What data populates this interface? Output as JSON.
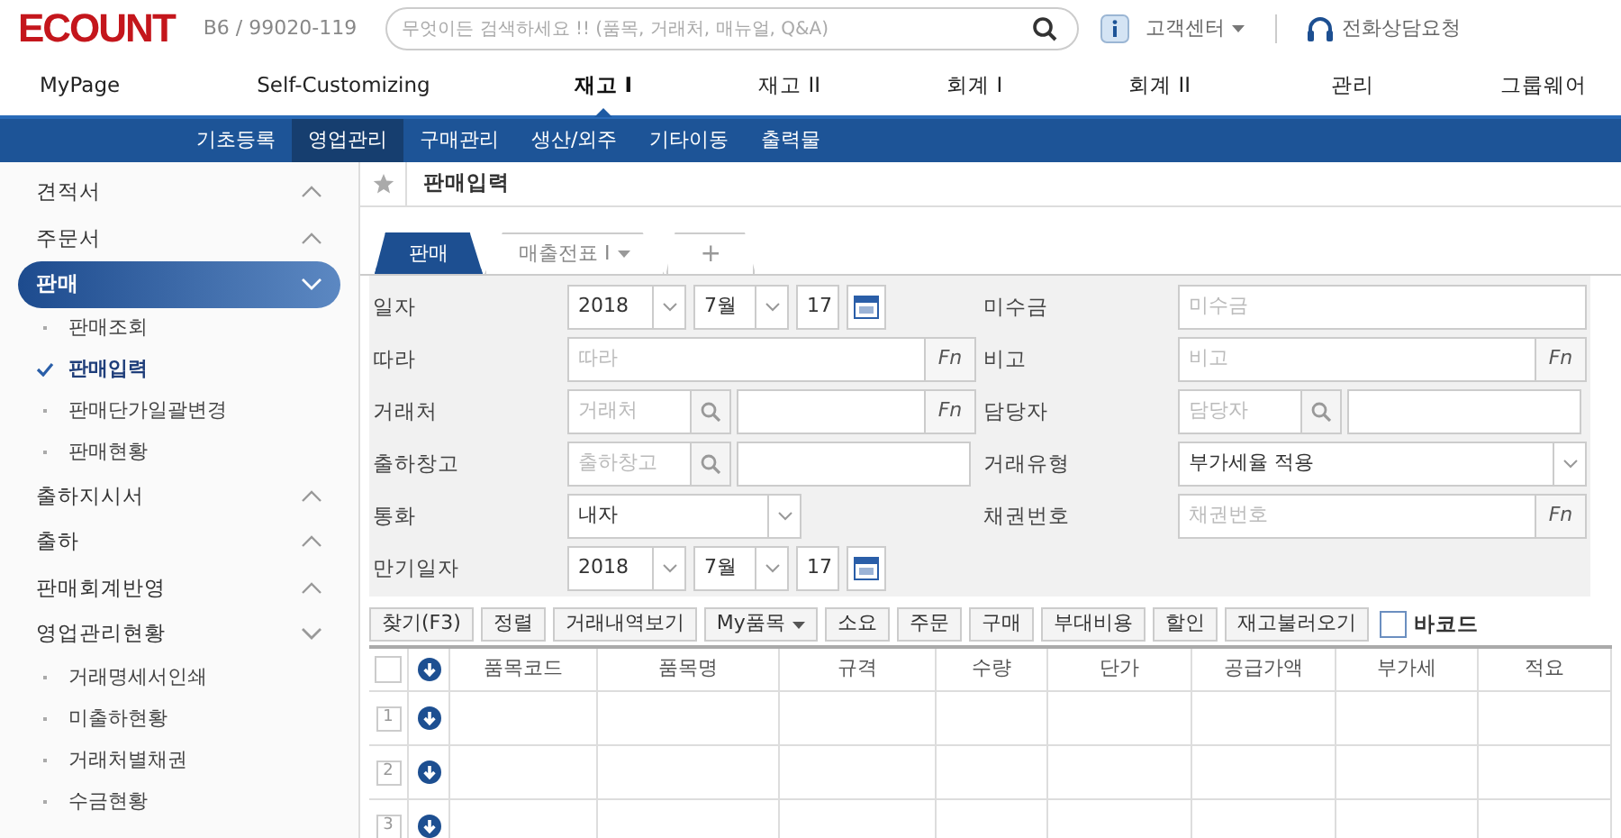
{
  "header": {
    "logo": "ECOUNT",
    "account": "B6 / 99020-119",
    "search_placeholder": "무엇이든 검색하세요 !! (품목, 거래처, 매뉴얼, Q&A)",
    "help": "고객센터",
    "phone": "전화상담요청"
  },
  "top_menu": [
    {
      "label": "MyPage",
      "selected": false
    },
    {
      "label": "Self-Customizing",
      "selected": false
    },
    {
      "label": "재고 I",
      "selected": true
    },
    {
      "label": "재고 II",
      "selected": false
    },
    {
      "label": "회계 I",
      "selected": false
    },
    {
      "label": "회계 II",
      "selected": false
    },
    {
      "label": "관리",
      "selected": false
    },
    {
      "label": "그룹웨어",
      "selected": false
    }
  ],
  "sub_menu": [
    {
      "label": "기초등록",
      "selected": false
    },
    {
      "label": "영업관리",
      "selected": true
    },
    {
      "label": "구매관리",
      "selected": false
    },
    {
      "label": "생산/외주",
      "selected": false
    },
    {
      "label": "기타이동",
      "selected": false
    },
    {
      "label": "출력물",
      "selected": false
    }
  ],
  "sidebar": [
    {
      "label": "견적서",
      "expanded": false,
      "selected": false
    },
    {
      "label": "주문서",
      "expanded": false,
      "selected": false
    },
    {
      "label": "판매",
      "expanded": true,
      "selected": true,
      "children": [
        {
          "label": "판매조회",
          "checked": false
        },
        {
          "label": "판매입력",
          "checked": true
        },
        {
          "label": "판매단가일괄변경",
          "checked": false
        },
        {
          "label": "판매현황",
          "checked": false
        }
      ]
    },
    {
      "label": "출하지시서",
      "expanded": false,
      "selected": false
    },
    {
      "label": "출하",
      "expanded": false,
      "selected": false
    },
    {
      "label": "판매회계반영",
      "expanded": false,
      "selected": false
    },
    {
      "label": "영업관리현황",
      "expanded": true,
      "selected": false,
      "children": [
        {
          "label": "거래명세서인쇄",
          "checked": false
        },
        {
          "label": "미출하현황",
          "checked": false
        },
        {
          "label": "거래처별채권",
          "checked": false
        },
        {
          "label": "수금현황",
          "checked": false
        }
      ]
    }
  ],
  "page_title": "판매입력",
  "tabs": [
    {
      "kind": "tab",
      "label": "판매",
      "selected": true
    },
    {
      "kind": "tab",
      "label": "매출전표 I",
      "selected": false
    },
    {
      "kind": "add",
      "label": "+",
      "selected": false
    }
  ],
  "form_left": [
    {
      "label": "일자",
      "kind": "date",
      "year": "2018",
      "month": "7월",
      "day": "17"
    },
    {
      "label": "따라",
      "kind": "text_fn",
      "placeholder": "따라",
      "button": "Fn"
    },
    {
      "label": "거래처",
      "kind": "search_fn",
      "placeholder": "거래처",
      "button": "Fn"
    },
    {
      "label": "출하창고",
      "kind": "search",
      "placeholder": "출하창고"
    },
    {
      "label": "통화",
      "kind": "select",
      "value": "내자"
    },
    {
      "label": "만기일자",
      "kind": "date",
      "year": "2018",
      "month": "7월",
      "day": "17"
    }
  ],
  "form_right": [
    {
      "label": "미수금",
      "kind": "text",
      "placeholder": "미수금"
    },
    {
      "label": "비고",
      "kind": "text_fn",
      "placeholder": "비고",
      "button": "Fn"
    },
    {
      "label": "담당자",
      "kind": "search",
      "placeholder": "담당자"
    },
    {
      "label": "거래유형",
      "kind": "select",
      "value": "부가세율 적용"
    },
    {
      "label": "채권번호",
      "kind": "text_fn",
      "placeholder": "채권번호",
      "button": "Fn"
    }
  ],
  "toolbar": [
    {
      "label": "찾기(F3)",
      "dropdown": false
    },
    {
      "label": "정렬",
      "dropdown": false
    },
    {
      "label": "거래내역보기",
      "dropdown": false
    },
    {
      "label": "My품목",
      "dropdown": true
    },
    {
      "label": "소요",
      "dropdown": false
    },
    {
      "label": "주문",
      "dropdown": false
    },
    {
      "label": "구매",
      "dropdown": false
    },
    {
      "label": "부대비용",
      "dropdown": false
    },
    {
      "label": "할인",
      "dropdown": false
    },
    {
      "label": "재고불러오기",
      "dropdown": false
    }
  ],
  "barcode": {
    "label": "바코드",
    "checked": false
  },
  "table": {
    "select_all": {
      "checked": false
    },
    "columns": [
      "품목코드",
      "품목명",
      "규격",
      "수량",
      "단가",
      "공급가액",
      "부가세",
      "적요"
    ],
    "rows": [
      "1",
      "2",
      "3"
    ]
  }
}
